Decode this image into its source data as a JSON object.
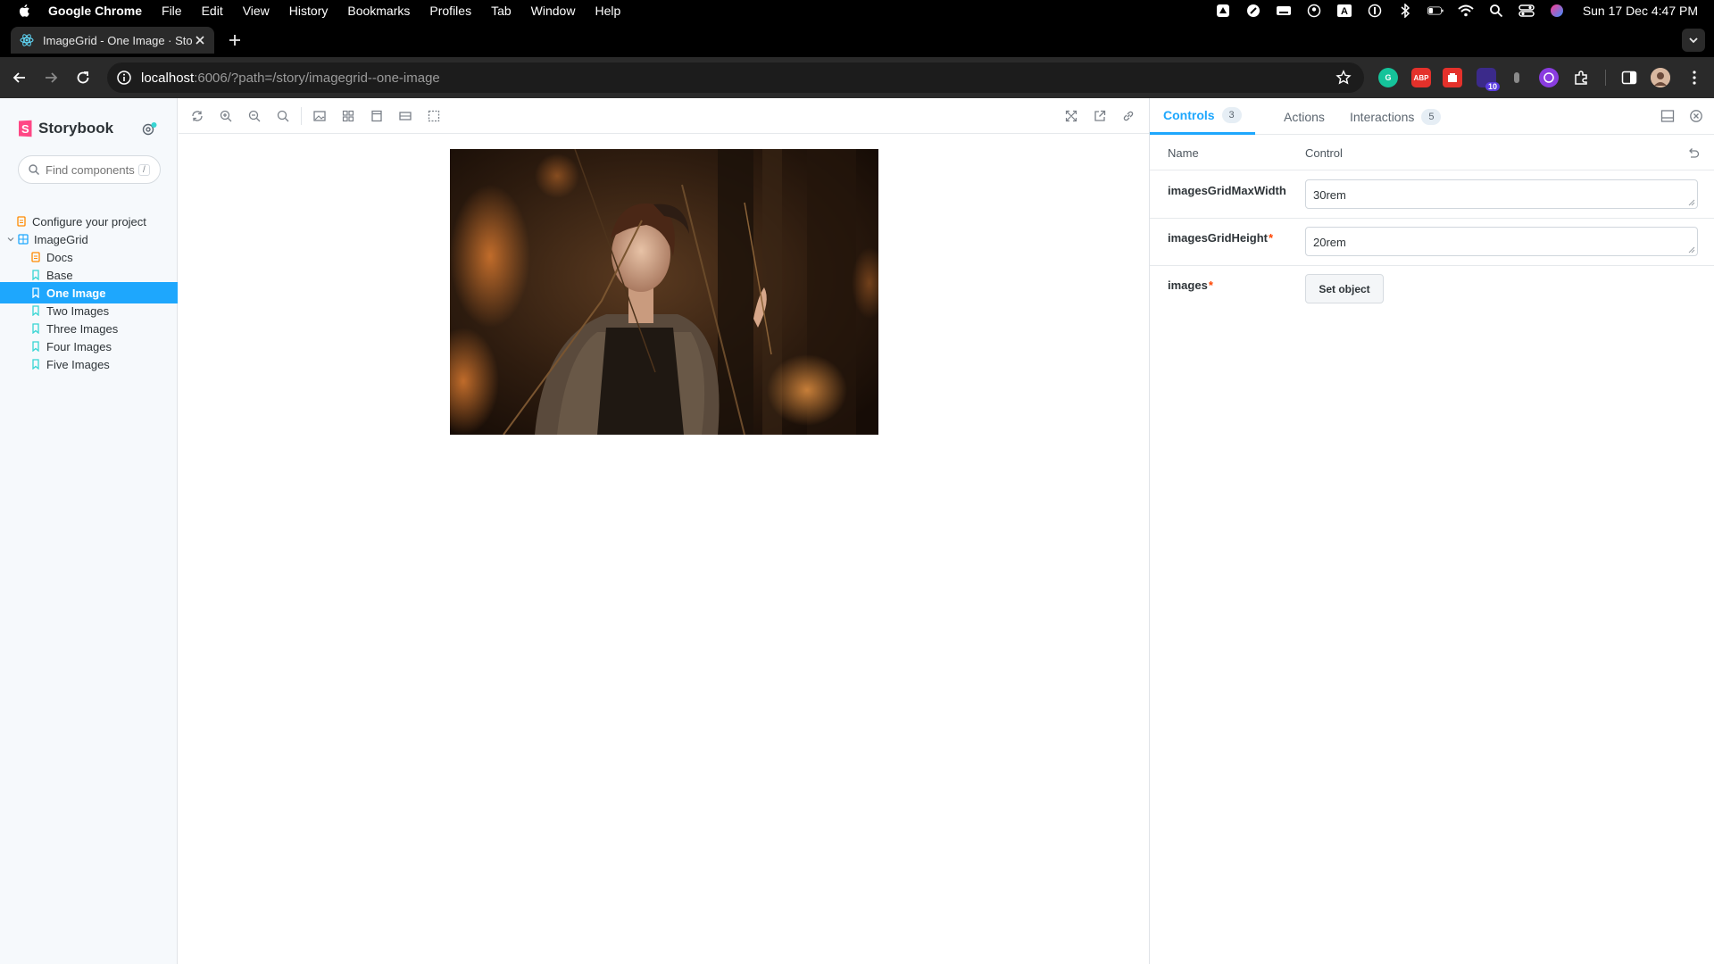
{
  "menubar": {
    "app": "Google Chrome",
    "items": [
      "File",
      "Edit",
      "View",
      "History",
      "Bookmarks",
      "Profiles",
      "Tab",
      "Window",
      "Help"
    ],
    "clock": "Sun 17 Dec  4:47 PM"
  },
  "browser": {
    "tab_title": "ImageGrid - One Image · Sto",
    "url_host": "localhost",
    "url_rest": ":6006/?path=/story/imagegrid--one-image",
    "ext_badge": "10"
  },
  "sidebar": {
    "brand": "Storybook",
    "search_placeholder": "Find components",
    "search_shortcut": "/",
    "items": [
      {
        "label": "Configure your project"
      },
      {
        "label": "ImageGrid"
      },
      {
        "label": "Docs"
      },
      {
        "label": "Base"
      },
      {
        "label": "One Image"
      },
      {
        "label": "Two Images"
      },
      {
        "label": "Three Images"
      },
      {
        "label": "Four Images"
      },
      {
        "label": "Five Images"
      }
    ]
  },
  "panel": {
    "tabs": [
      {
        "label": "Controls",
        "count": "3"
      },
      {
        "label": "Actions"
      },
      {
        "label": "Interactions",
        "count": "5"
      }
    ],
    "columns": {
      "name": "Name",
      "control": "Control"
    },
    "rows": [
      {
        "name": "imagesGridMaxWidth",
        "required": "",
        "value": "30rem"
      },
      {
        "name": "imagesGridHeight",
        "required": "*",
        "value": "20rem"
      },
      {
        "name": "images",
        "required": "*",
        "button": "Set object"
      }
    ]
  },
  "colors": {
    "accent": "#1ea7fd",
    "storybook_pink": "#ff4785",
    "required": "#ff4400"
  }
}
